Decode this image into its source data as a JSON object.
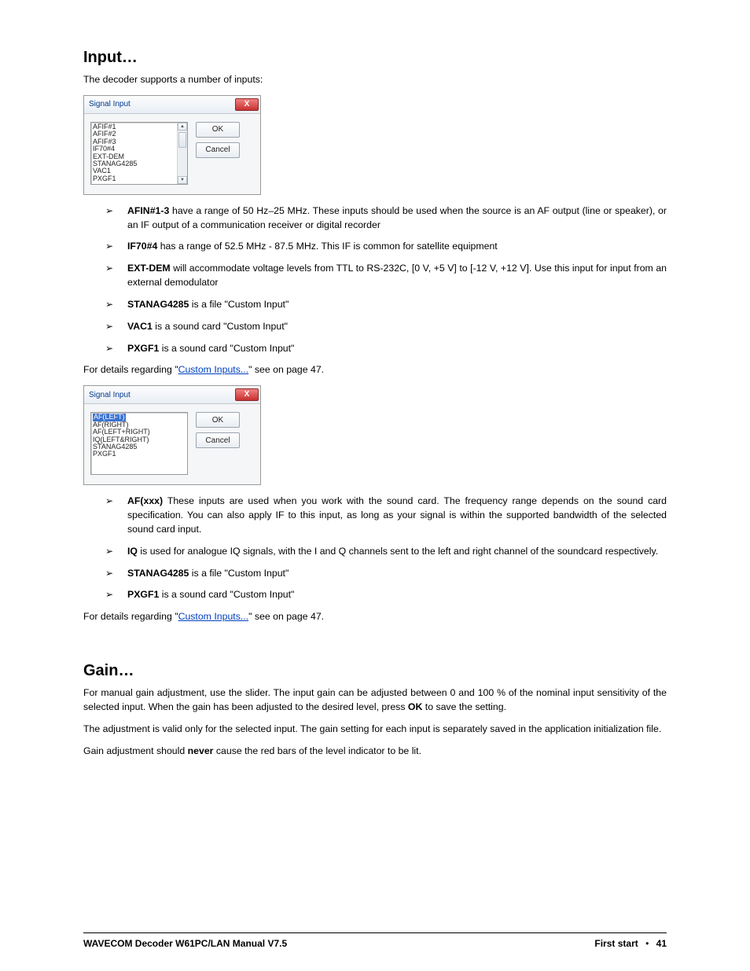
{
  "headings": {
    "input": "Input…",
    "gain": "Gain…"
  },
  "intro": {
    "input": "The decoder supports a number of inputs:"
  },
  "dialog1": {
    "title": "Signal Input",
    "close": "X",
    "ok": "OK",
    "cancel": "Cancel",
    "items": [
      "AFIF#1",
      "AFIF#2",
      "AFIF#3",
      "IF70#4",
      "EXT-DEM",
      "STANAG4285",
      "VAC1",
      "PXGF1"
    ]
  },
  "list1": {
    "i0_label": "AFIN#1-3",
    "i0_text": " have a range of 50 Hz–25 MHz. These inputs should be used when the source is an AF output (line or speaker), or an IF output of a communication receiver or digital recorder",
    "i1_label": "IF70#4",
    "i1_text": " has a range of 52.5 MHz - 87.5 MHz. This IF is common for satellite equipment",
    "i2_label": "EXT-DEM",
    "i2_text": " will accommodate voltage levels from TTL to RS-232C, [0 V, +5 V] to [-12 V, +12 V]. Use this input for input from an external demodulator",
    "i3_label": "STANAG4285",
    "i3_text": " is a file \"Custom Input\"",
    "i4_label": "VAC1",
    "i4_text": " is a sound card \"Custom Input\"",
    "i5_label": "PXGF1",
    "i5_text": " is a sound card \"Custom Input\""
  },
  "details": {
    "prefix": "For details regarding \"",
    "link": "Custom Inputs...",
    "suffix1": "\" see on page 47.",
    "suffix2": "\"  see on page 47."
  },
  "dialog2": {
    "title": "Signal Input",
    "close": "X",
    "ok": "OK",
    "cancel": "Cancel",
    "selected": "AF(LEFT)",
    "items_rest": [
      "AF(RIGHT)",
      "AF(LEFT+RIGHT)",
      "IQ(LEFT&RIGHT)",
      "STANAG4285",
      "PXGF1"
    ]
  },
  "list2": {
    "i0_label": "AF(xxx)",
    "i0_text": " These inputs are used when you work with the sound card. The frequency range depends on the sound card specification. You can also apply IF to this input, as long as your signal is within the supported bandwidth of the selected sound card input.",
    "i1_label": "IQ",
    "i1_text": " is used for analogue IQ signals, with the I and Q channels sent to the left and right channel of the soundcard respectively.",
    "i2_label": "STANAG4285",
    "i2_text": " is a file \"Custom Input\"",
    "i3_label": "PXGF1",
    "i3_text": " is a sound card \"Custom Input\""
  },
  "gain": {
    "p1a": "For manual gain adjustment, use the slider. The input gain can be adjusted between 0 and 100 % of the nominal input sensitivity of the selected input. When the gain has been adjusted to the desired level, press ",
    "p1b_bold": "OK",
    "p1c": " to save the setting.",
    "p2": "The adjustment is valid only for the selected input. The gain setting for each input is separately saved in the application initialization file.",
    "p3a": "Gain adjustment should ",
    "p3b_bold": "never",
    "p3c": " cause the red bars of the level indicator to be lit."
  },
  "footer": {
    "left": "WAVECOM Decoder W61PC/LAN Manual V7.5",
    "right_section": "First start",
    "dot": "•",
    "page": "41"
  }
}
